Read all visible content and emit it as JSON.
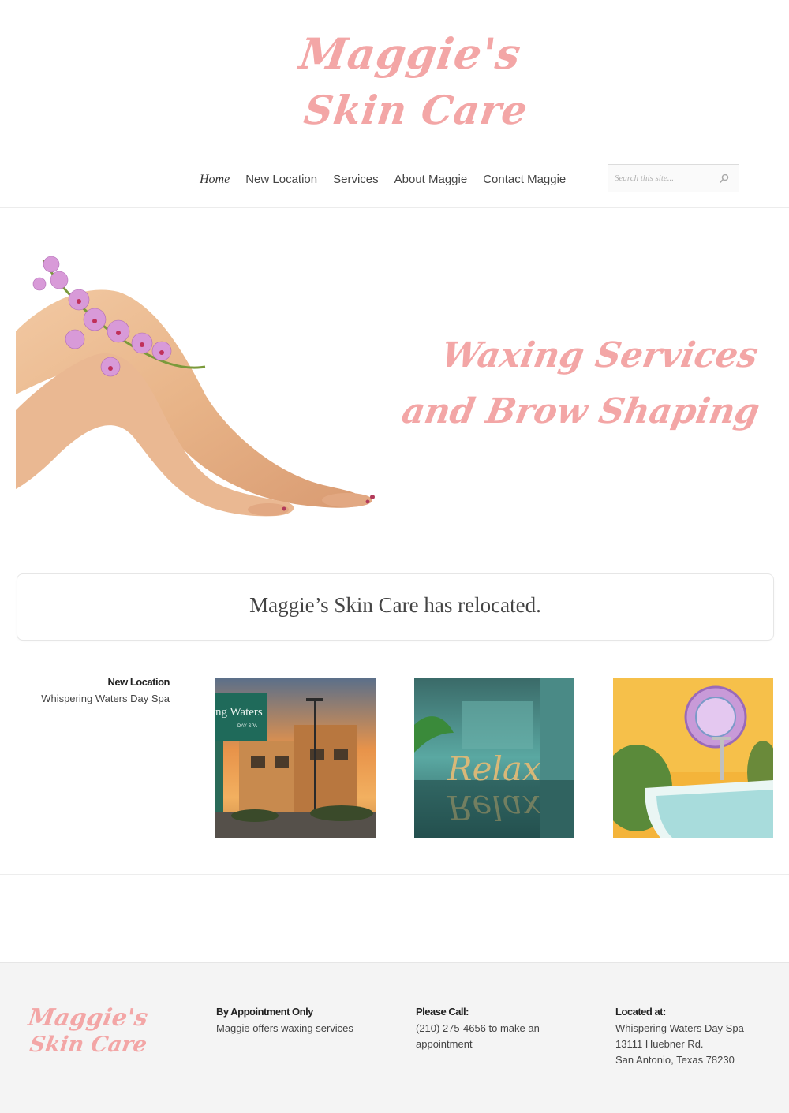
{
  "site": {
    "logo_line1": "Maggie's",
    "logo_line2": "Skin Care",
    "brand_color": "#f3a6a6"
  },
  "nav": {
    "items": [
      {
        "label": "Home",
        "active": true
      },
      {
        "label": "New Location"
      },
      {
        "label": "Services"
      },
      {
        "label": "About Maggie"
      },
      {
        "label": "Contact Maggie"
      }
    ],
    "search_placeholder": "Search this site...",
    "search_icon": "search-icon"
  },
  "hero": {
    "line1": "Waxing Services",
    "line2": "and Brow Shaping"
  },
  "notice": {
    "text": "Maggie’s Skin Care has relocated."
  },
  "location": {
    "heading": "New Location",
    "name": "Whispering Waters Day Spa",
    "photo1_sign": "ng Waters",
    "photo1_sub": "DAY SPA",
    "photo2_text": "Relax"
  },
  "footer": {
    "logo_line1": "Maggie's",
    "logo_line2": "Skin Care",
    "col1": {
      "heading": "By Appointment Only",
      "text": "Maggie offers waxing services"
    },
    "col2": {
      "heading": "Please Call:",
      "text_line1": "(210) 275-4656 to make an",
      "text_line2": "appointment"
    },
    "col3": {
      "heading": "Located at:",
      "line1": "Whispering Waters Day Spa",
      "line2": "13111 Huebner Rd.",
      "line3": "San Antonio, Texas 78230"
    }
  }
}
